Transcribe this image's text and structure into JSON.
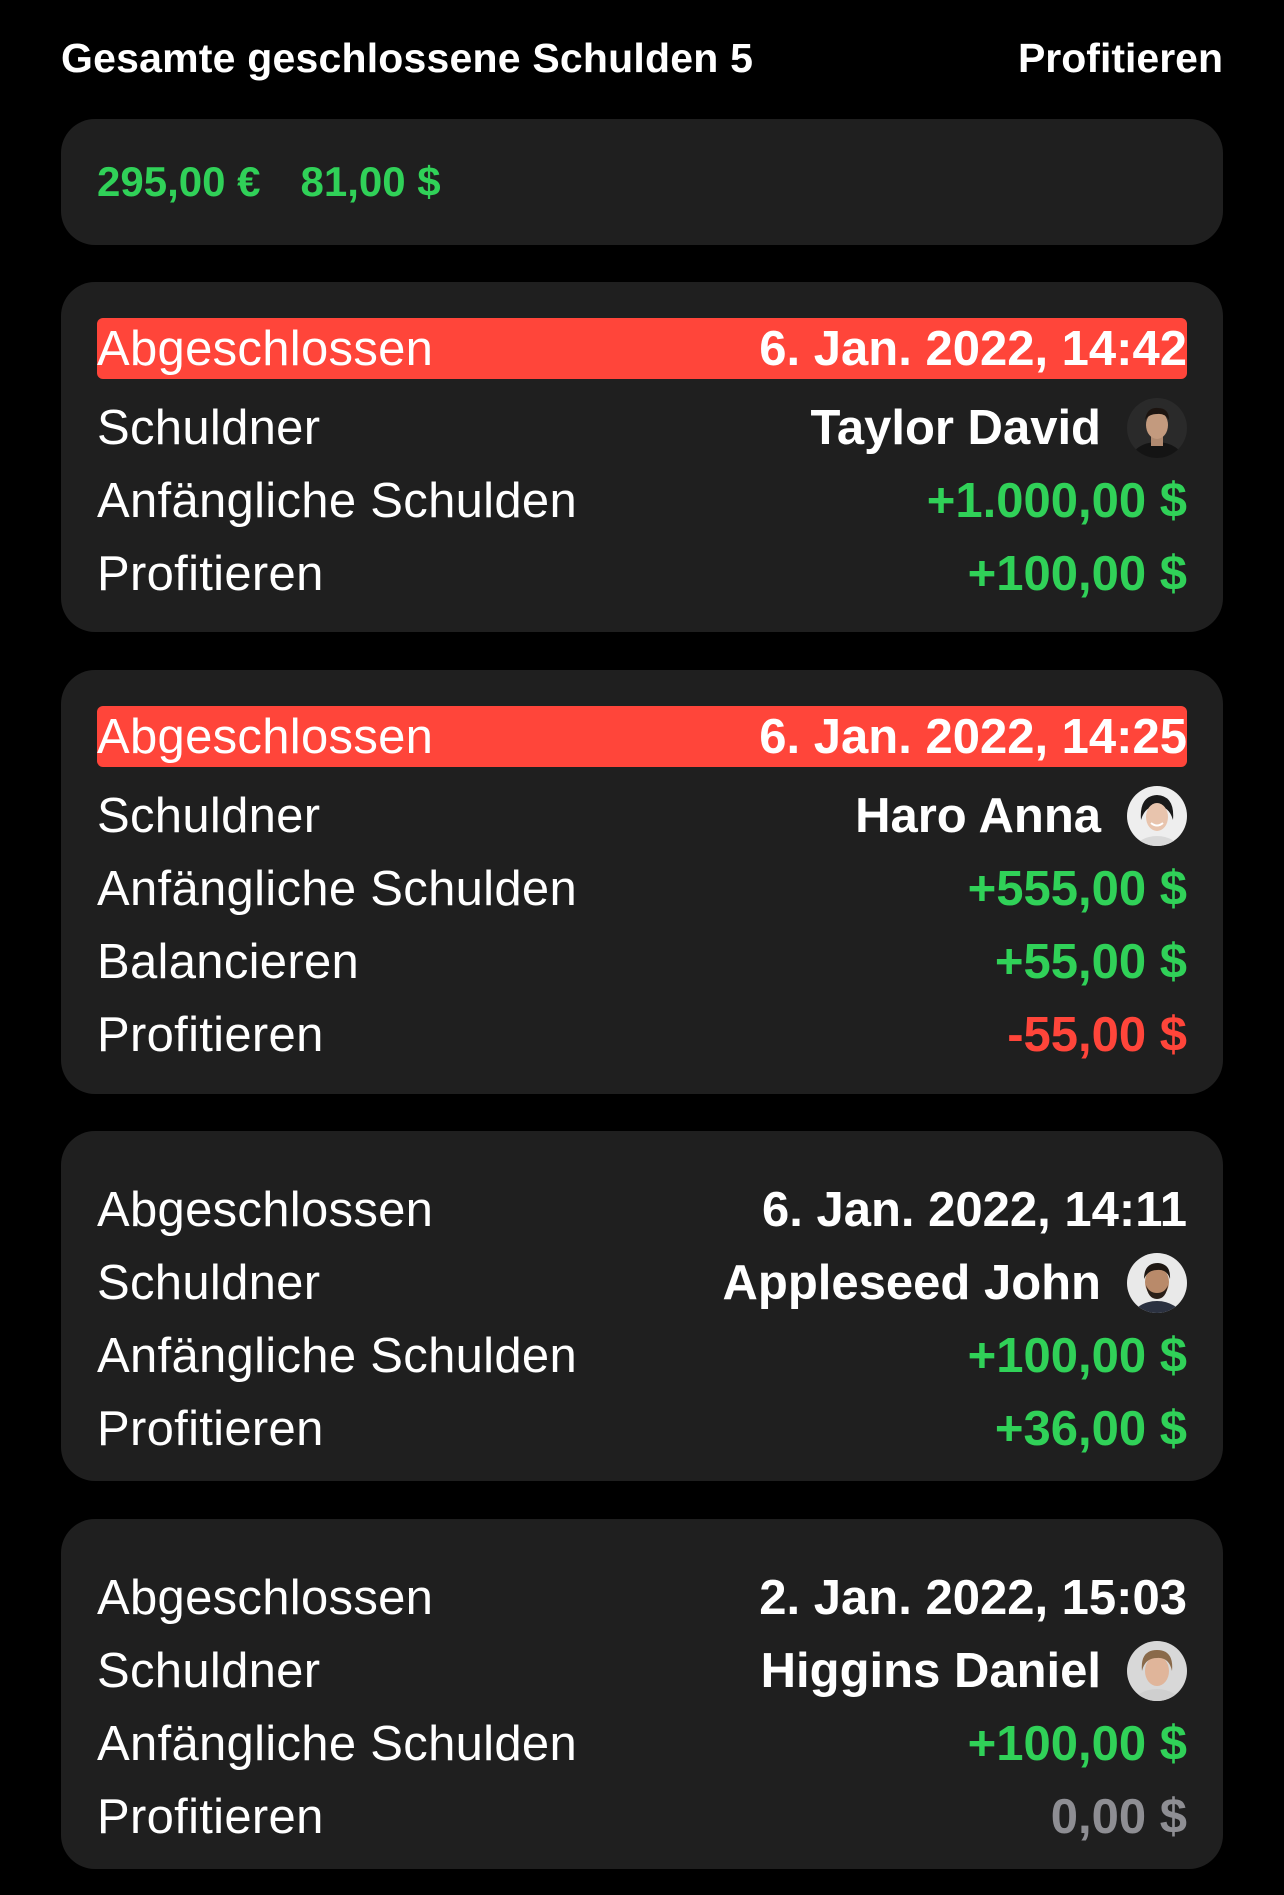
{
  "header": {
    "title": "Gesamte geschlossene Schulden 5",
    "action": "Profitieren"
  },
  "summary": {
    "eur": "295,00 €",
    "usd": "81,00 $"
  },
  "colors": {
    "accent_green": "#30d158",
    "accent_red": "#ff453a",
    "gray": "#8e8e93",
    "card_bg": "#1f1f1f"
  },
  "cards": [
    {
      "closed_label": "Abgeschlossen",
      "closed_date": "6. Jan. 2022, 14:42",
      "debtor_label": "Schuldner",
      "debtor_name": "Taylor David",
      "initial_label": "Anfängliche Schulden",
      "initial_value": "+1.000,00 $",
      "profit_label": "Profitieren",
      "profit_value": "+100,00 $"
    },
    {
      "closed_label": "Abgeschlossen",
      "closed_date": "6. Jan. 2022, 14:25",
      "debtor_label": "Schuldner",
      "debtor_name": "Haro Anna",
      "initial_label": "Anfängliche Schulden",
      "initial_value": "+555,00 $",
      "balance_label": "Balancieren",
      "balance_value": "+55,00 $",
      "profit_label": "Profitieren",
      "profit_value": "-55,00 $"
    },
    {
      "closed_label": "Abgeschlossen",
      "closed_date": "6. Jan. 2022, 14:11",
      "debtor_label": "Schuldner",
      "debtor_name": "Appleseed John",
      "initial_label": "Anfängliche Schulden",
      "initial_value": "+100,00 $",
      "profit_label": "Profitieren",
      "profit_value": "+36,00 $"
    },
    {
      "closed_label": "Abgeschlossen",
      "closed_date": "2. Jan. 2022, 15:03",
      "debtor_label": "Schuldner",
      "debtor_name": "Higgins Daniel",
      "initial_label": "Anfängliche Schulden",
      "initial_value": "+100,00 $",
      "profit_label": "Profitieren",
      "profit_value": "0,00 $"
    }
  ]
}
